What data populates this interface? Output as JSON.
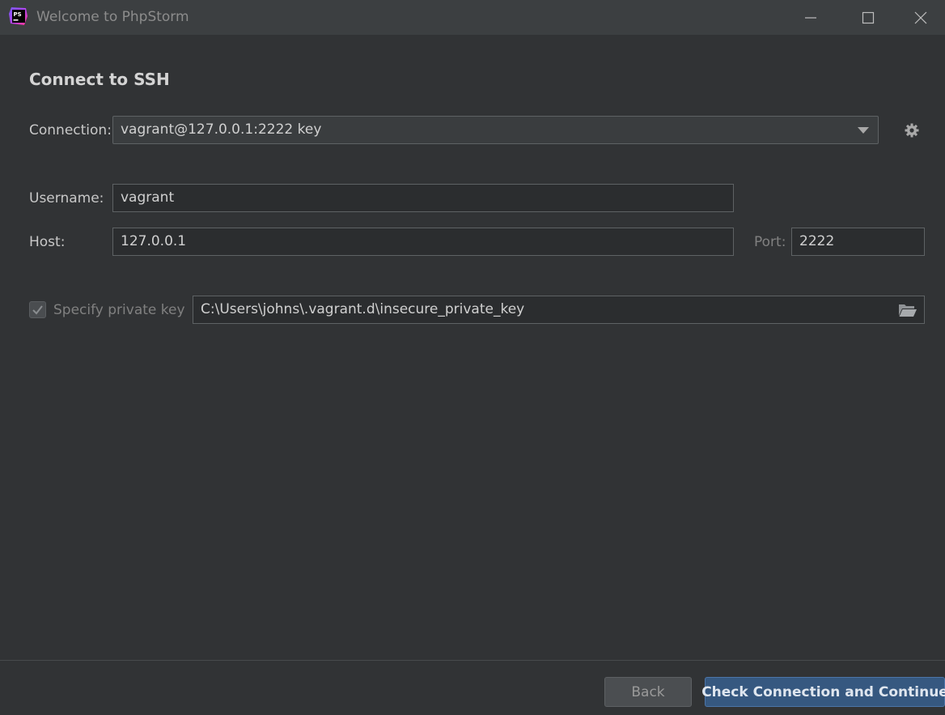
{
  "window": {
    "title": "Welcome to PhpStorm",
    "logo_text": "PS",
    "controls": {
      "minimize": "minimize-icon",
      "maximize": "maximize-icon",
      "close": "close-icon"
    }
  },
  "form": {
    "heading": "Connect to SSH",
    "connection": {
      "label": "Connection:",
      "value": "vagrant@127.0.0.1:2222 key",
      "settings_icon": "gear-icon"
    },
    "username": {
      "label": "Username:",
      "value": "vagrant"
    },
    "host": {
      "label": "Host:",
      "value": "127.0.0.1"
    },
    "port": {
      "label": "Port:",
      "value": "2222"
    },
    "private_key": {
      "label": "Specify private key",
      "checked": true,
      "enabled": false,
      "path": "C:\\Users\\johns\\.vagrant.d\\insecure_private_key",
      "browse_icon": "folder-open-icon"
    }
  },
  "footer": {
    "back_label": "Back",
    "continue_label": "Check Connection and Continue"
  },
  "colors": {
    "background": "#313335",
    "titlebar": "#3c3f41",
    "primary_button": "#365880",
    "logo_accent": "#b345f1"
  }
}
